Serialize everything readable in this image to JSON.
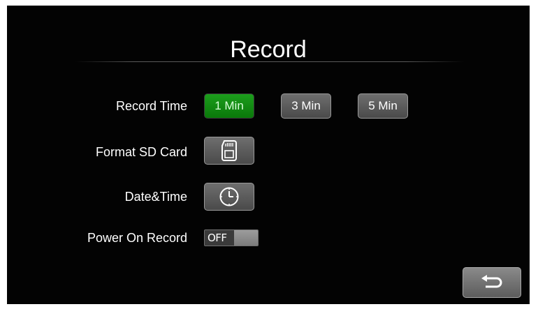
{
  "screen": {
    "title": "Record",
    "settings": {
      "record_time": {
        "label": "Record Time",
        "options": [
          "1 Min",
          "3 Min",
          "5 Min"
        ],
        "selected": "1 Min"
      },
      "format_sd": {
        "label": "Format SD Card",
        "icon": "sd-card-icon"
      },
      "date_time": {
        "label": "Date&Time",
        "icon": "clock-icon"
      },
      "power_on_record": {
        "label": "Power On Record",
        "state": "OFF"
      }
    },
    "back": {
      "icon": "back-arrow-icon"
    },
    "colors": {
      "background": "#030303",
      "selected": "#0e8c0e",
      "button": "#5a5a5a",
      "text": "#ffffff"
    }
  }
}
